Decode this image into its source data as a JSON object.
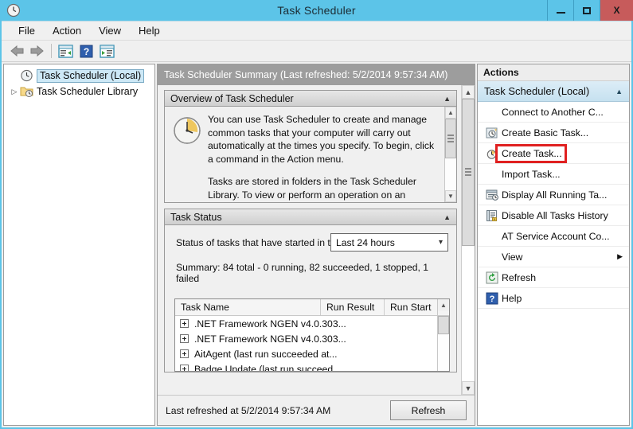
{
  "window": {
    "title": "Task Scheduler",
    "icon": "clock-icon",
    "accent_color": "#5cc4e8",
    "close_color": "#c75b5b",
    "buttons": {
      "minimize": "minimize-button",
      "maximize": "maximize-button",
      "close": "X"
    }
  },
  "menubar": {
    "items": [
      {
        "label": "File"
      },
      {
        "label": "Action"
      },
      {
        "label": "View"
      },
      {
        "label": "Help"
      }
    ]
  },
  "toolbar": {
    "items": [
      {
        "name": "back-button",
        "icon": "arrow-left-icon"
      },
      {
        "name": "forward-button",
        "icon": "arrow-right-icon"
      },
      {
        "name": "show-hide-console-tree-button",
        "icon": "tree-pane-icon"
      },
      {
        "name": "help-button",
        "icon": "question-mark-icon"
      },
      {
        "name": "show-hide-action-pane-button",
        "icon": "action-pane-icon"
      }
    ]
  },
  "tree": {
    "items": [
      {
        "label": "Task Scheduler (Local)",
        "icon": "clock-icon",
        "selected": true,
        "expandable": false
      },
      {
        "label": "Task Scheduler Library",
        "icon": "folder-clock-icon",
        "selected": false,
        "expandable": true,
        "twisty": "▷"
      }
    ]
  },
  "content": {
    "header": "Task Scheduler Summary (Last refreshed: 5/2/2014 9:57:34 AM)",
    "overview": {
      "title": "Overview of Task Scheduler",
      "caret": "▲",
      "icon": "clock-large-icon",
      "paragraph1": "You can use Task Scheduler to create and manage common tasks that your computer will carry out automatically at the times you specify. To begin, click a command in the Action menu.",
      "paragraph2": "Tasks are stored in folders in the Task Scheduler Library. To view or perform an operation on an"
    },
    "task_status": {
      "title": "Task Status",
      "caret": "▲",
      "status_label": "Status of tasks that have started in t...",
      "period_value": "Last 24 hours",
      "period_caret": "⌄",
      "summary": "Summary: 84 total - 0 running, 82 succeeded, 1 stopped, 1 failed",
      "table": {
        "columns": [
          "Task Name",
          "Run Result",
          "Run Start"
        ],
        "rows": [
          {
            "task_name": ".NET Framework NGEN v4.0.303...",
            "run_result": "",
            "run_start": ""
          },
          {
            "task_name": ".NET Framework NGEN v4.0.303...",
            "run_result": "",
            "run_start": ""
          },
          {
            "task_name": "AitAgent (last run succeeded at...",
            "run_result": "",
            "run_start": ""
          },
          {
            "task_name": "Badge Update (last run succeed...",
            "run_result": "",
            "run_start": ""
          }
        ]
      }
    }
  },
  "statusbar": {
    "text": "Last refreshed at 5/2/2014 9:57:34 AM",
    "refresh_label": "Refresh"
  },
  "actions": {
    "header": "Actions",
    "group_title": "Task Scheduler (Local)",
    "group_caret": "▲",
    "highlight_color": "#e02020",
    "items": [
      {
        "label": "Connect to Another C...",
        "icon": "",
        "highlighted": false,
        "submenu": false
      },
      {
        "label": "Create Basic Task...",
        "icon": "create-basic-task-icon",
        "highlighted": false,
        "submenu": false
      },
      {
        "label": "Create Task...",
        "icon": "create-task-icon",
        "highlighted": true,
        "submenu": false
      },
      {
        "label": "Import Task...",
        "icon": "",
        "highlighted": false,
        "submenu": false
      },
      {
        "label": "Display All Running Ta...",
        "icon": "display-running-tasks-icon",
        "highlighted": false,
        "submenu": false
      },
      {
        "label": "Disable All Tasks History",
        "icon": "disable-history-icon",
        "highlighted": false,
        "submenu": false
      },
      {
        "label": "AT Service Account Co...",
        "icon": "",
        "highlighted": false,
        "submenu": false
      },
      {
        "label": "View",
        "icon": "",
        "highlighted": false,
        "submenu": true,
        "arrow": "▶"
      },
      {
        "label": "Refresh",
        "icon": "refresh-icon",
        "highlighted": false,
        "submenu": false
      },
      {
        "label": "Help",
        "icon": "help-icon",
        "highlighted": false,
        "submenu": false
      }
    ]
  }
}
